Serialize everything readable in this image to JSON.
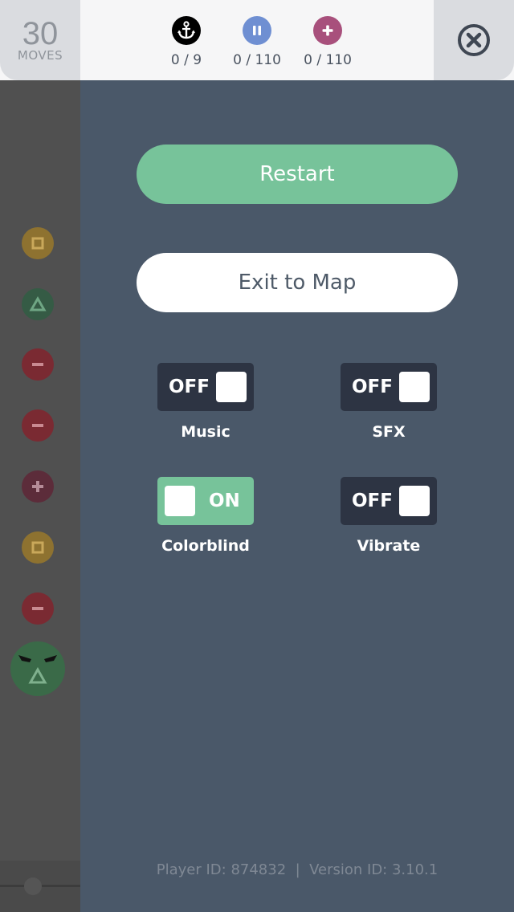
{
  "header": {
    "moves_count": "30",
    "moves_label": "MOVES",
    "goals": [
      {
        "icon": "anchor-icon",
        "color": "#000000",
        "progress": "0 / 9"
      },
      {
        "icon": "pause-gem-icon",
        "color": "#6f8fd2",
        "progress": "0 / 110"
      },
      {
        "icon": "plus-gem-icon",
        "color": "#a8507c",
        "progress": "0 / 110"
      }
    ],
    "close_icon": "close-circle-icon"
  },
  "menu": {
    "restart_label": "Restart",
    "exit_label": "Exit to Map",
    "toggles": [
      {
        "caption": "Music",
        "state_label": "OFF",
        "on": false
      },
      {
        "caption": "SFX",
        "state_label": "OFF",
        "on": false
      },
      {
        "caption": "Colorblind",
        "state_label": "ON",
        "on": true
      },
      {
        "caption": "Vibrate",
        "state_label": "OFF",
        "on": false
      }
    ],
    "colors": {
      "accent": "#77c39a",
      "panel": "#4a5869",
      "toggle_off": "#2d3443"
    }
  },
  "footer": {
    "text": "Player ID: 874832  |  Version ID: 3.10.1"
  },
  "board": {
    "pieces": [
      "square",
      "triangle",
      "minus",
      "minus",
      "plus",
      "square",
      "minus",
      "triangle-face"
    ]
  }
}
